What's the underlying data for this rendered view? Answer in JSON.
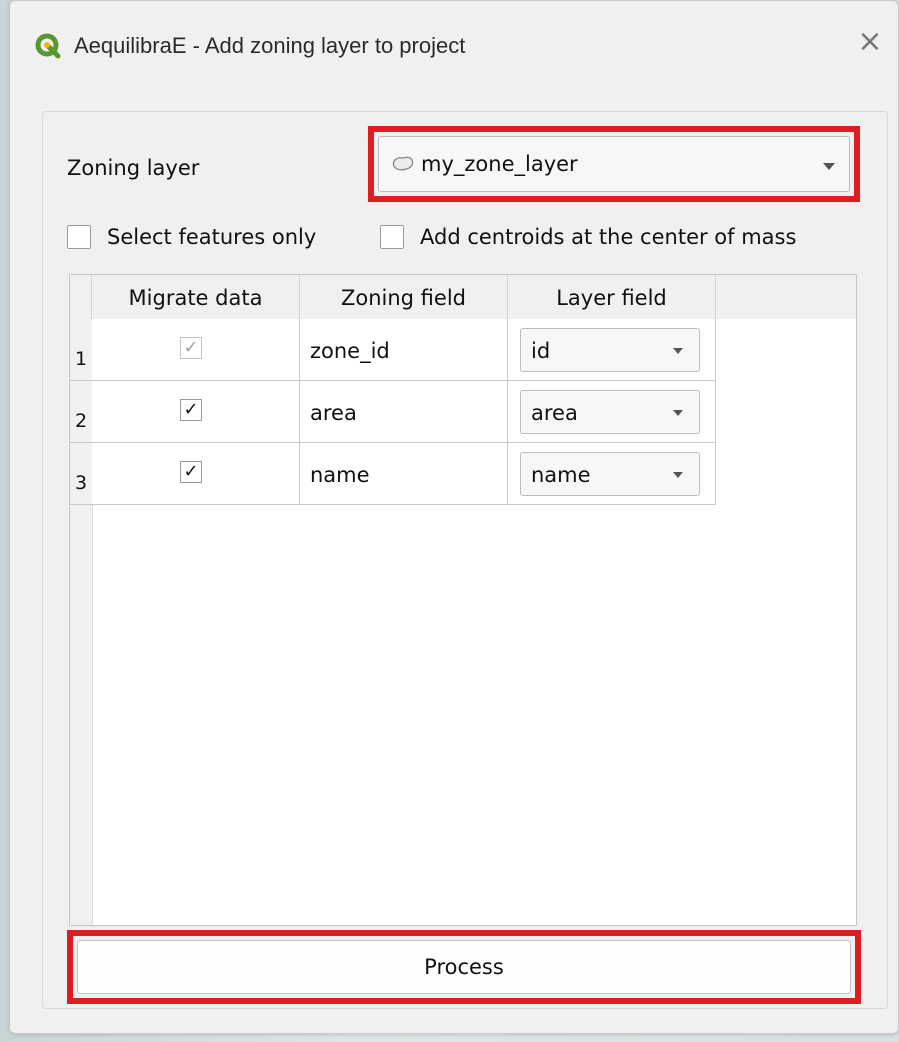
{
  "window": {
    "title": "AequilibraE - Add zoning layer to project",
    "close_glyph": "×",
    "app_icon": "qgis-icon"
  },
  "form": {
    "zoning_layer_label": "Zoning layer",
    "zoning_layer_value": "my_zone_layer",
    "layer_icon": "polygon-layer-icon",
    "select_features_only": {
      "label": "Select features only",
      "checked": false
    },
    "add_centroids": {
      "label": "Add centroids at the center of mass",
      "checked": false
    }
  },
  "table": {
    "headers": [
      "Migrate data",
      "Zoning field",
      "Layer field"
    ],
    "rows": [
      {
        "num": "1",
        "migrate": "✓",
        "migrate_disabled": true,
        "zoning_field": "zone_id",
        "layer_field": "id"
      },
      {
        "num": "2",
        "migrate": "✓",
        "migrate_disabled": false,
        "zoning_field": "area",
        "layer_field": "area"
      },
      {
        "num": "3",
        "migrate": "✓",
        "migrate_disabled": false,
        "zoning_field": "name",
        "layer_field": "name"
      }
    ]
  },
  "actions": {
    "process_label": "Process"
  },
  "colors": {
    "highlight": "#e11b22",
    "qgis_green": "#589632"
  }
}
